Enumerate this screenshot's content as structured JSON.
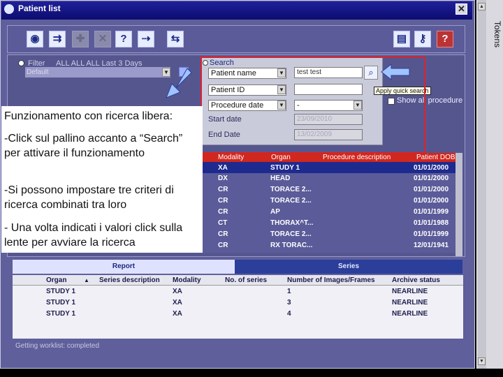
{
  "window": {
    "title": "Patient list",
    "close_label": "✕"
  },
  "side_panel": {
    "label": "Tokens"
  },
  "toolbar": {
    "icons": [
      "•→88",
      "→88",
      "?",
      "✕",
      "?",
      "→5",
      "?3",
      "?",
      "?"
    ]
  },
  "filter": {
    "label": "Filter",
    "options_text": "ALL   ALL   ALL   Last 3 Days",
    "preset_value": "Default"
  },
  "search": {
    "label": "Search",
    "criteria": [
      {
        "field": "Patient name",
        "value": "test test"
      },
      {
        "field": "Patient ID",
        "value": ""
      },
      {
        "field": "Procedure date",
        "value": "-"
      }
    ],
    "start_date_label": "Start date",
    "start_date_value": "23/09/2010",
    "end_date_label": "End Date",
    "end_date_value": "13/02/2009",
    "tooltip": "Apply quick search",
    "show_all_label": "Show all procedure"
  },
  "worklist": {
    "columns": [
      "Modality",
      "Organ",
      "Procedure description",
      "Patient DOB"
    ],
    "rows": [
      {
        "modality": "XA",
        "organ": "STUDY 1",
        "description": "",
        "dob": "01/01/2000",
        "selected": true
      },
      {
        "modality": "DX",
        "organ": "HEAD",
        "description": "",
        "dob": "01/01/2000",
        "selected": false
      },
      {
        "modality": "CR",
        "organ": "TORACE 2...",
        "description": "",
        "dob": "01/01/2000",
        "selected": false
      },
      {
        "modality": "CR",
        "organ": "TORACE 2...",
        "description": "",
        "dob": "01/01/2000",
        "selected": false
      },
      {
        "modality": "CR",
        "organ": "AP",
        "description": "",
        "dob": "01/01/1999",
        "selected": false
      },
      {
        "modality": "CT",
        "organ": "THORAX^T...",
        "description": "",
        "dob": "01/01/1988",
        "selected": false
      },
      {
        "modality": "CR",
        "organ": "TORACE 2...",
        "description": "",
        "dob": "01/01/1999",
        "selected": false
      },
      {
        "modality": "CR",
        "organ": "RX TORAC...",
        "description": "",
        "dob": "12/01/1941",
        "selected": false
      }
    ]
  },
  "tabs": {
    "report": "Report",
    "series": "Series"
  },
  "series_table": {
    "columns": [
      "Organ",
      "Series description",
      "Modality",
      "No. of series",
      "Number of Images/Frames",
      "Archive status"
    ],
    "rows": [
      {
        "organ": "STUDY 1",
        "description": "",
        "modality": "XA",
        "series": "",
        "images": "1",
        "status": "NEARLINE"
      },
      {
        "organ": "STUDY 1",
        "description": "",
        "modality": "XA",
        "series": "",
        "images": "3",
        "status": "NEARLINE"
      },
      {
        "organ": "STUDY 1",
        "description": "",
        "modality": "XA",
        "series": "",
        "images": "4",
        "status": "NEARLINE"
      }
    ]
  },
  "status_text": "Getting worklist: completed",
  "annotation": {
    "title": "Funzionamento con ricerca libera:",
    "p1": "-Click sul pallino accanto a “Search” per attivare il funzionamento",
    "p2": "-Si possono impostare tre criteri di ricerca combinati tra loro",
    "p3": "- Una volta indicati i valori click sulla lente per avviare la ricerca"
  },
  "colors": {
    "highlight_box": "#e0212a",
    "grid_header": "#d0271e",
    "selected_row": "#1e2a8e",
    "window_bg": "#5f5f9c"
  }
}
